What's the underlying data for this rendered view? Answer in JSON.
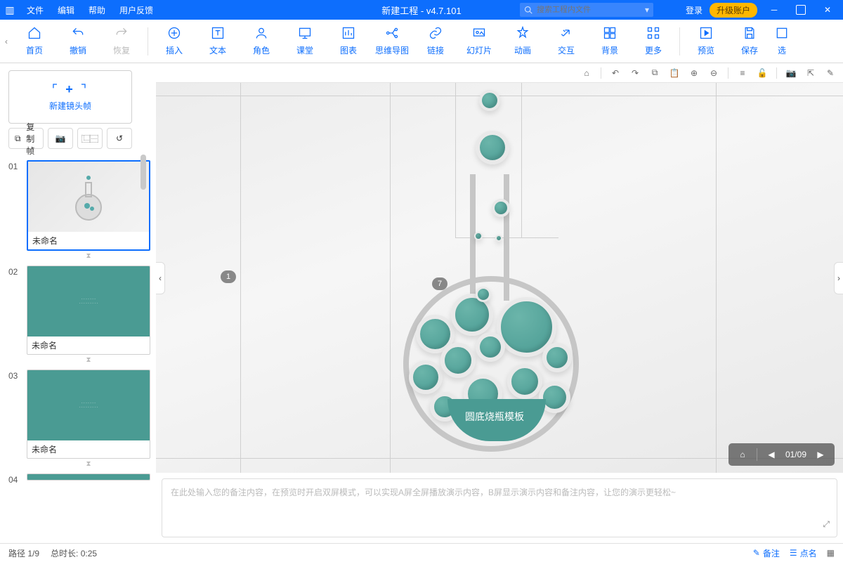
{
  "titlebar": {
    "menus": [
      "文件",
      "编辑",
      "帮助",
      "用户反馈"
    ],
    "title": "新建工程 - v4.7.101",
    "search_placeholder": "搜索工程内文件",
    "login": "登录",
    "upgrade": "升级账户"
  },
  "toolbar": {
    "items": [
      {
        "label": "首页",
        "icon": "home-icon"
      },
      {
        "label": "撤销",
        "icon": "undo-icon"
      },
      {
        "label": "恢复",
        "icon": "redo-icon",
        "disabled": true
      }
    ],
    "items2": [
      {
        "label": "插入",
        "icon": "insert-icon"
      },
      {
        "label": "文本",
        "icon": "text-icon"
      },
      {
        "label": "角色",
        "icon": "role-icon"
      },
      {
        "label": "课堂",
        "icon": "class-icon"
      },
      {
        "label": "图表",
        "icon": "chart-icon"
      },
      {
        "label": "思维导图",
        "icon": "mindmap-icon"
      },
      {
        "label": "链接",
        "icon": "link-icon"
      },
      {
        "label": "幻灯片",
        "icon": "slide-icon"
      },
      {
        "label": "动画",
        "icon": "anim-icon"
      },
      {
        "label": "交互",
        "icon": "interact-icon"
      },
      {
        "label": "背景",
        "icon": "bg-icon"
      },
      {
        "label": "更多",
        "icon": "more-icon"
      }
    ],
    "items3": [
      {
        "label": "预览",
        "icon": "preview-icon"
      },
      {
        "label": "保存",
        "icon": "save-icon"
      },
      {
        "label": "选",
        "icon": "select-icon"
      }
    ]
  },
  "sidebar": {
    "new_frame": "新建镜头帧",
    "copy_frame": "复制帧",
    "thumbs": [
      {
        "num": "01",
        "label": "未命名",
        "active": true,
        "teal": false
      },
      {
        "num": "02",
        "label": "未命名",
        "active": false,
        "teal": true
      },
      {
        "num": "03",
        "label": "未命名",
        "active": false,
        "teal": true
      },
      {
        "num": "04",
        "label": "",
        "active": false,
        "teal": true
      }
    ]
  },
  "canvas": {
    "markers": [
      "1",
      "7"
    ],
    "flask_label": "圆底烧瓶模板",
    "pager": {
      "current": "01",
      "total": "09",
      "sep": "/"
    }
  },
  "notes": {
    "placeholder": "在此处输入您的备注内容，在预览时开启双屏模式，可以实现A屏全屏播放演示内容，B屏显示演示内容和备注内容，让您的演示更轻松~"
  },
  "statusbar": {
    "path_label": "路径 1/9",
    "duration_label": "总时长: 0:25",
    "notes_btn": "备注",
    "comment_btn": "点名"
  }
}
